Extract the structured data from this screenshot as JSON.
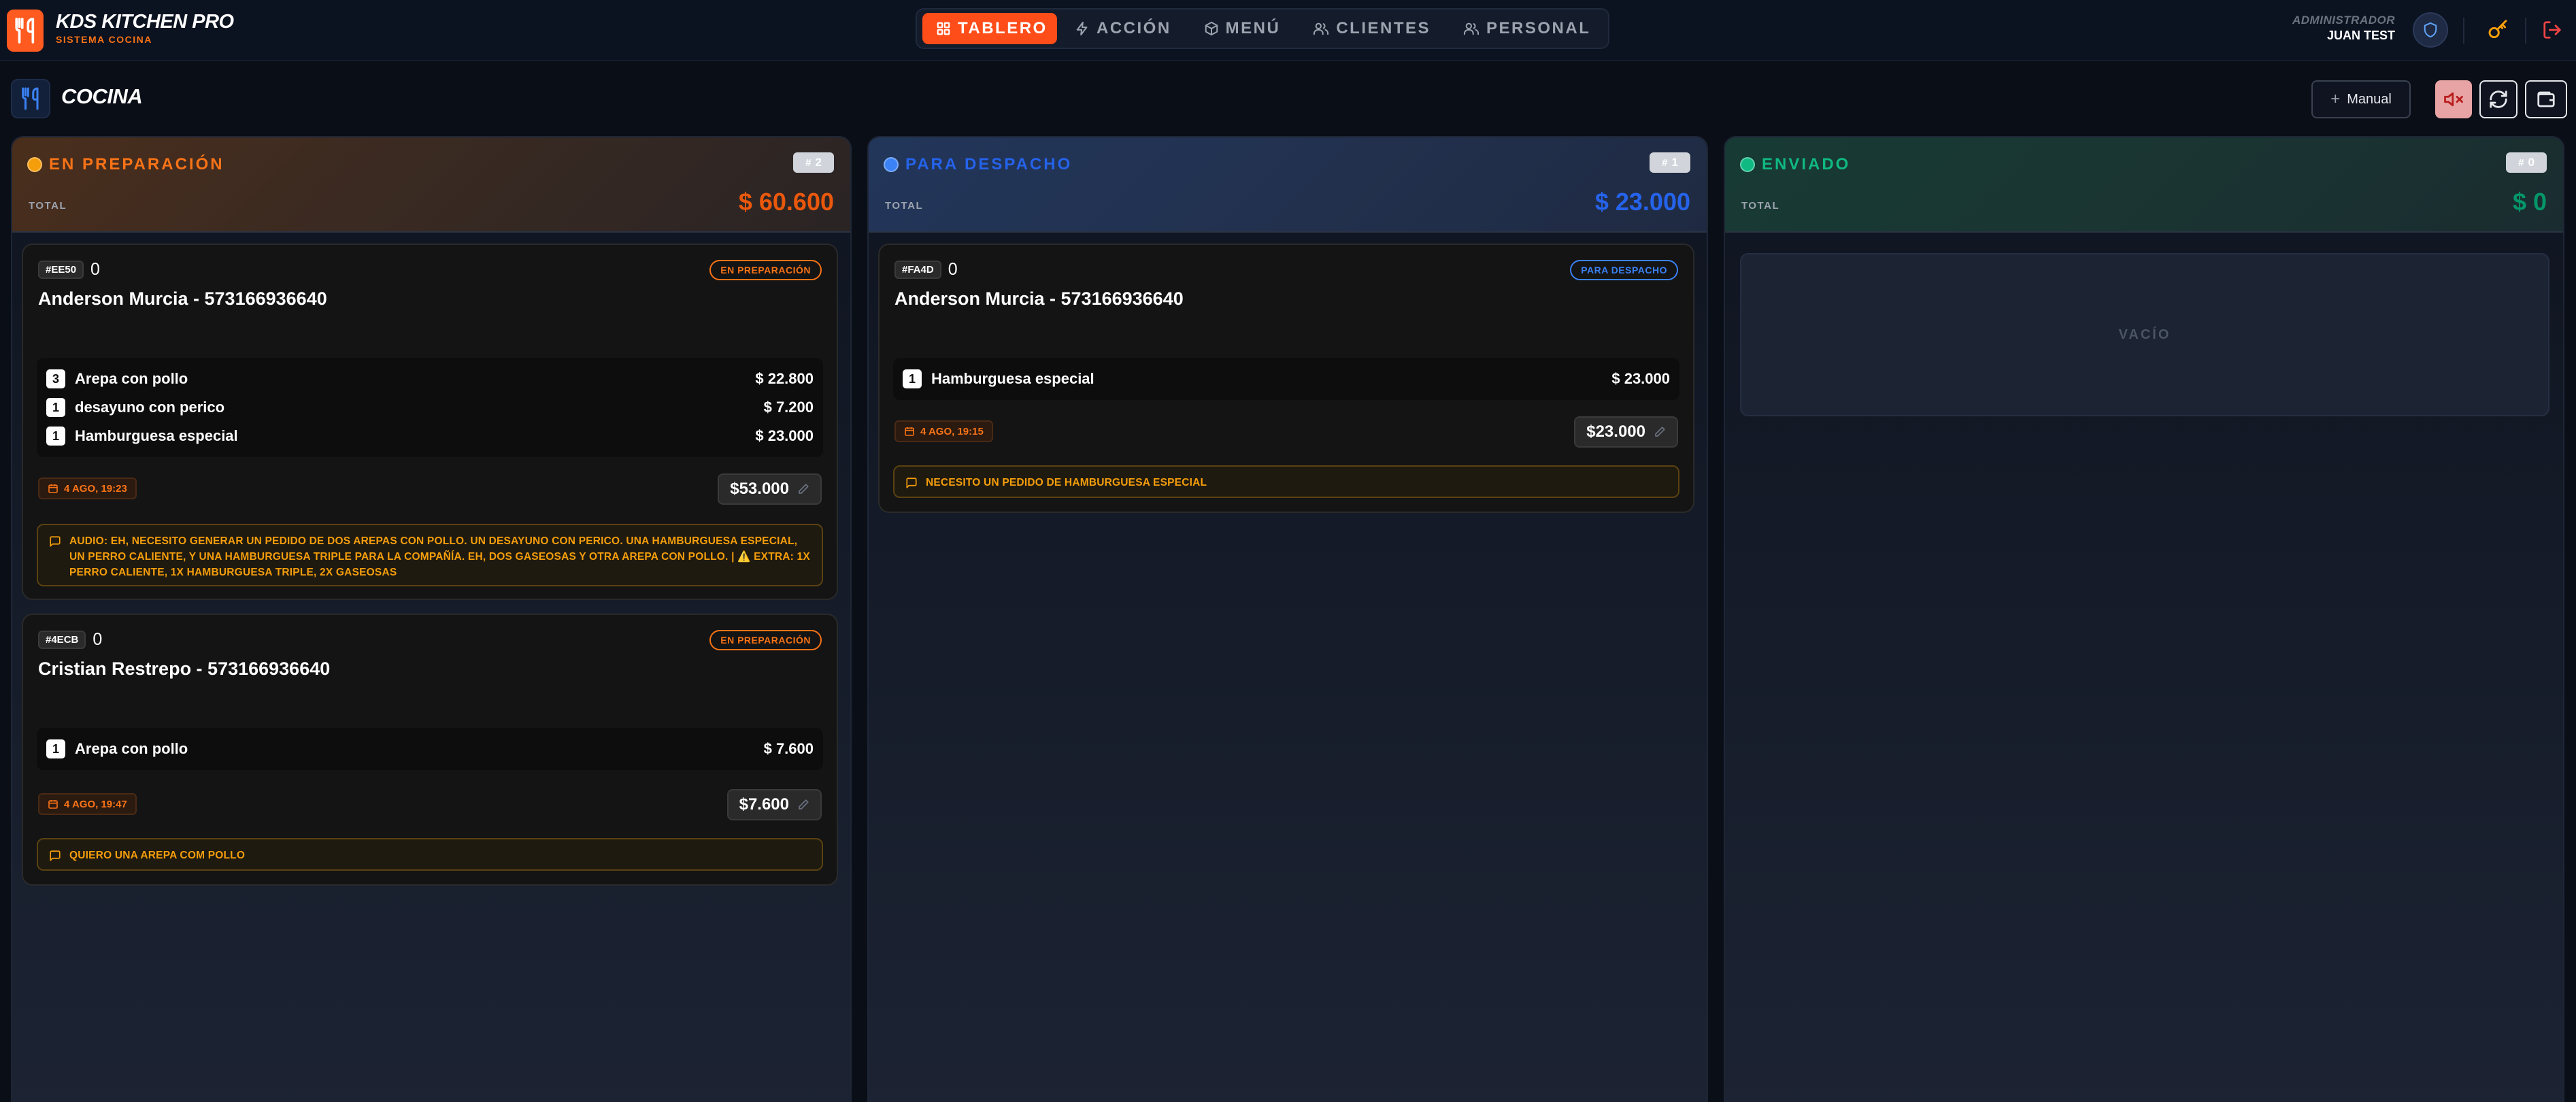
{
  "app": {
    "title": "KDS KITCHEN PRO",
    "subtitle": "SISTEMA COCINA"
  },
  "nav": {
    "tablero": "TABLERO",
    "accion": "ACCIÓN",
    "menu": "MENÚ",
    "clientes": "CLIENTES",
    "personal": "PERSONAL"
  },
  "user": {
    "role": "ADMINISTRADOR",
    "name": "JUAN TEST"
  },
  "page": {
    "title": "COCINA",
    "manual_label": "Manual"
  },
  "colors": {
    "accent": "#ff4d1a",
    "preparacion": "#f97316",
    "despacho": "#2563eb",
    "enviado": "#10b981"
  },
  "columns": [
    {
      "status": "EN PREPARACIÓN",
      "count": "2",
      "total_label": "TOTAL",
      "total": "$ 60.600",
      "cards": [
        {
          "id": "#EE50",
          "zero": "0",
          "status": "EN PREPARACIÓN",
          "customer": "Anderson Murcia - 573166936640",
          "items": [
            {
              "qty": "3",
              "name": "Arepa con pollo",
              "price": "$ 22.800"
            },
            {
              "qty": "1",
              "name": "desayuno con perico",
              "price": "$ 7.200"
            },
            {
              "qty": "1",
              "name": "Hamburguesa especial",
              "price": "$ 23.000"
            }
          ],
          "date": "4 AGO, 19:23",
          "total": "$53.000",
          "note": "AUDIO: EH, NECESITO GENERAR UN PEDIDO DE DOS AREPAS CON POLLO. UN DESAYUNO CON PERICO. UNA HAMBURGUESA ESPECIAL, UN PERRO CALIENTE, Y UNA HAMBURGUESA TRIPLE PARA LA COMPAÑÍA. EH, DOS GASEOSAS Y OTRA AREPA CON POLLO. | ⚠️ EXTRA: 1X PERRO CALIENTE, 1X HAMBURGUESA TRIPLE, 2X GASEOSAS"
        },
        {
          "id": "#4ECB",
          "zero": "0",
          "status": "EN PREPARACIÓN",
          "customer": "Cristian Restrepo - 573166936640",
          "items": [
            {
              "qty": "1",
              "name": "Arepa con pollo",
              "price": "$ 7.600"
            }
          ],
          "date": "4 AGO, 19:47",
          "total": "$7.600",
          "note": "QUIERO UNA AREPA COM POLLO"
        }
      ]
    },
    {
      "status": "PARA DESPACHO",
      "count": "1",
      "total_label": "TOTAL",
      "total": "$ 23.000",
      "cards": [
        {
          "id": "#FA4D",
          "zero": "0",
          "status": "PARA DESPACHO",
          "customer": "Anderson Murcia - 573166936640",
          "items": [
            {
              "qty": "1",
              "name": "Hamburguesa especial",
              "price": "$ 23.000"
            }
          ],
          "date": "4 AGO, 19:15",
          "total": "$23.000",
          "note": "NECESITO UN PEDIDO DE HAMBURGUESA ESPECIAL"
        }
      ]
    },
    {
      "status": "ENVIADO",
      "count": "0",
      "total_label": "TOTAL",
      "total": "$ 0",
      "empty": "VACÍO"
    }
  ]
}
